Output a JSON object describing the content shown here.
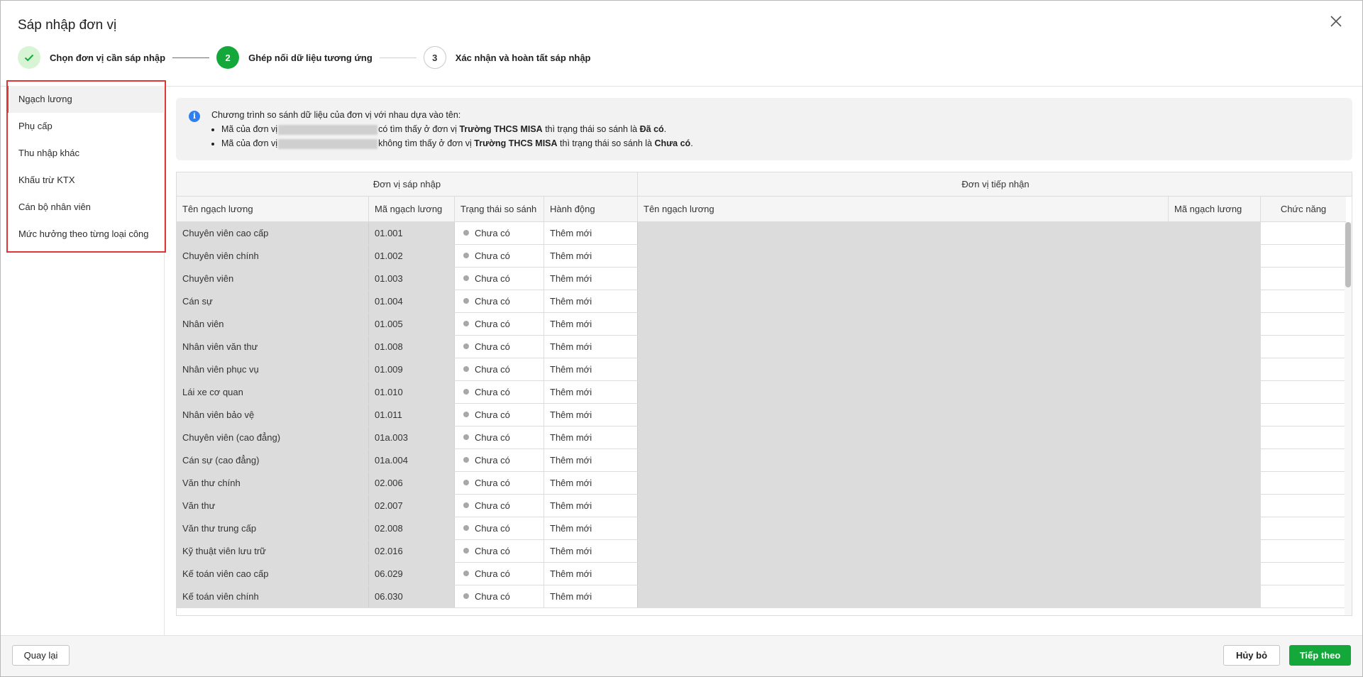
{
  "dialog": {
    "title": "Sáp nhập đơn vị"
  },
  "stepper": {
    "steps": [
      {
        "number": "1",
        "label": "Chọn đơn vị cần sáp nhập",
        "state": "done"
      },
      {
        "number": "2",
        "label": "Ghép nối dữ liệu tương ứng",
        "state": "active"
      },
      {
        "number": "3",
        "label": "Xác nhận và hoàn tất sáp nhập",
        "state": "todo"
      }
    ]
  },
  "sidebar": {
    "items": [
      {
        "label": "Ngạch lương",
        "active": true
      },
      {
        "label": "Phụ cấp"
      },
      {
        "label": "Thu nhập khác"
      },
      {
        "label": "Khấu trừ KTX"
      },
      {
        "label": "Cán bộ nhân viên"
      },
      {
        "label": "Mức hưởng theo từng loại công"
      }
    ]
  },
  "info": {
    "intro": "Chương trình so sánh dữ liệu của đơn vị với nhau dựa vào tên:",
    "line1_a": "Mã của đơn vị",
    "line1_b": "có tìm thấy ở đơn vị",
    "line1_unit": "Trường THCS MISA",
    "line1_c": "thì trạng thái so sánh là",
    "line1_status": "Đã có",
    "line2_a": "Mã của đơn vị",
    "line2_b": "không tìm thấy ở đơn vị",
    "line2_unit": "Trường THCS MISA",
    "line2_c": "thì trạng thái so sánh là",
    "line2_status": "Chưa có"
  },
  "table": {
    "group_source": "Đơn vị sáp nhập",
    "group_target": "Đơn vị tiếp nhận",
    "columns": {
      "src_name": "Tên ngạch lương",
      "src_code": "Mã ngạch lương",
      "status": "Trạng thái so sánh",
      "action": "Hành động",
      "dst_name": "Tên ngạch lương",
      "dst_code": "Mã ngạch lương",
      "function": "Chức năng"
    },
    "rows": [
      {
        "name": "Chuyên viên cao cấp",
        "code": "01.001",
        "status": "Chưa có",
        "action": "Thêm mới"
      },
      {
        "name": "Chuyên viên chính",
        "code": "01.002",
        "status": "Chưa có",
        "action": "Thêm mới"
      },
      {
        "name": "Chuyên viên",
        "code": "01.003",
        "status": "Chưa có",
        "action": "Thêm mới"
      },
      {
        "name": "Cán sự",
        "code": "01.004",
        "status": "Chưa có",
        "action": "Thêm mới"
      },
      {
        "name": "Nhân viên",
        "code": "01.005",
        "status": "Chưa có",
        "action": "Thêm mới"
      },
      {
        "name": "Nhân viên văn thư",
        "code": "01.008",
        "status": "Chưa có",
        "action": "Thêm mới"
      },
      {
        "name": "Nhân viên phục vụ",
        "code": "01.009",
        "status": "Chưa có",
        "action": "Thêm mới"
      },
      {
        "name": "Lái xe cơ quan",
        "code": "01.010",
        "status": "Chưa có",
        "action": "Thêm mới"
      },
      {
        "name": "Nhân viên bảo vệ",
        "code": "01.011",
        "status": "Chưa có",
        "action": "Thêm mới"
      },
      {
        "name": "Chuyên viên (cao đẳng)",
        "code": "01a.003",
        "status": "Chưa có",
        "action": "Thêm mới"
      },
      {
        "name": "Cán sự (cao đẳng)",
        "code": "01a.004",
        "status": "Chưa có",
        "action": "Thêm mới"
      },
      {
        "name": "Văn thư chính",
        "code": "02.006",
        "status": "Chưa có",
        "action": "Thêm mới"
      },
      {
        "name": "Văn thư",
        "code": "02.007",
        "status": "Chưa có",
        "action": "Thêm mới"
      },
      {
        "name": "Văn thư trung cấp",
        "code": "02.008",
        "status": "Chưa có",
        "action": "Thêm mới"
      },
      {
        "name": "Kỹ thuật viên lưu trữ",
        "code": "02.016",
        "status": "Chưa có",
        "action": "Thêm mới"
      },
      {
        "name": "Kế toán viên cao cấp",
        "code": "06.029",
        "status": "Chưa có",
        "action": "Thêm mới"
      },
      {
        "name": "Kế toán viên chính",
        "code": "06.030",
        "status": "Chưa có",
        "action": "Thêm mới"
      }
    ]
  },
  "footer": {
    "back": "Quay lại",
    "cancel": "Hủy bỏ",
    "next": "Tiếp theo"
  },
  "colors": {
    "accent": "#14a83b",
    "highlight_border": "#e03636",
    "info_icon": "#2f7ff2"
  },
  "icons": {
    "close": "close-icon",
    "check": "check-icon",
    "info": "info-icon",
    "status_dot": "status-dot-icon"
  }
}
